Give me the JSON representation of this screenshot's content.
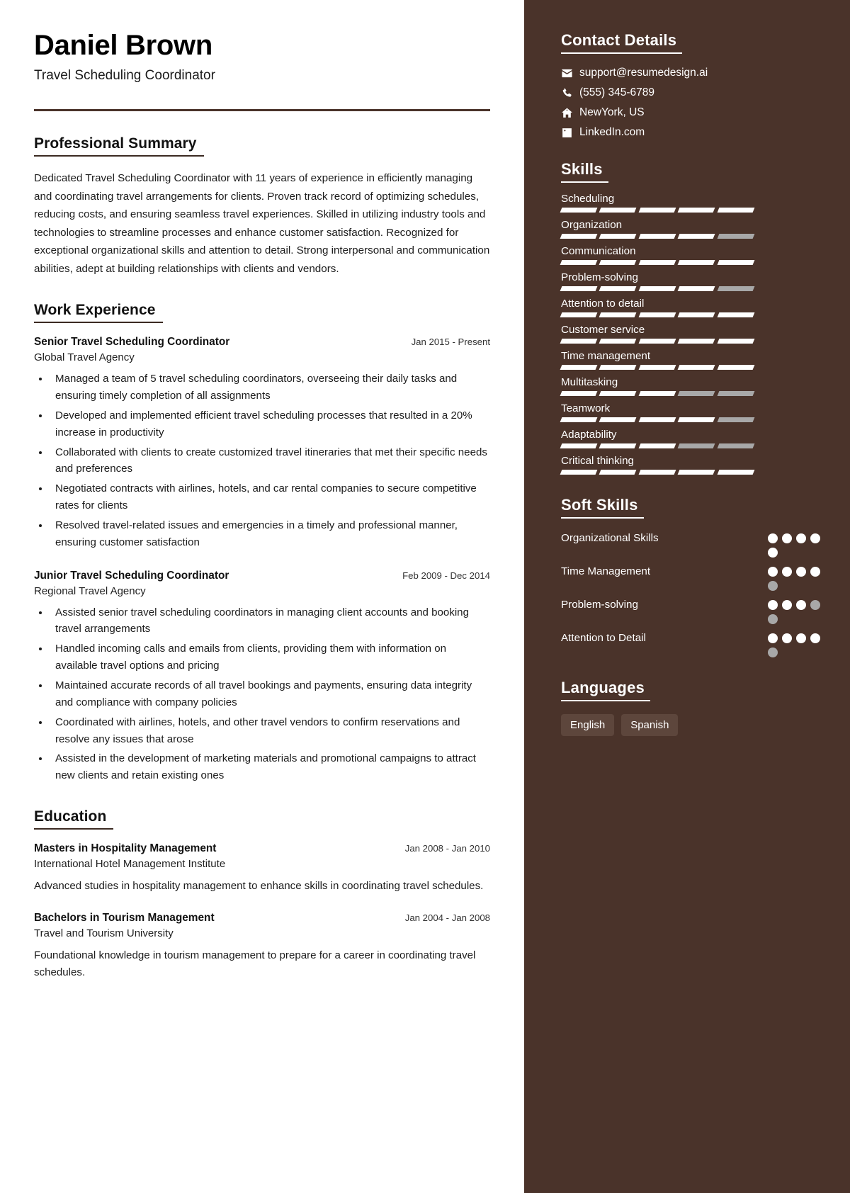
{
  "header": {
    "name": "Daniel Brown",
    "job_title": "Travel Scheduling Coordinator"
  },
  "main": {
    "summary": {
      "heading": "Professional Summary",
      "text": "Dedicated Travel Scheduling Coordinator with 11 years of experience in efficiently managing and coordinating travel arrangements for clients. Proven track record of optimizing schedules, reducing costs, and ensuring seamless travel experiences. Skilled in utilizing industry tools and technologies to streamline processes and enhance customer satisfaction. Recognized for exceptional organizational skills and attention to detail. Strong interpersonal and communication abilities, adept at building relationships with clients and vendors."
    },
    "experience": {
      "heading": "Work Experience",
      "items": [
        {
          "title": "Senior Travel Scheduling Coordinator",
          "date": "Jan 2015 - Present",
          "organization": "Global Travel Agency",
          "bullets": [
            "Managed a team of 5 travel scheduling coordinators, overseeing their daily tasks and ensuring timely completion of all assignments",
            "Developed and implemented efficient travel scheduling processes that resulted in a 20% increase in productivity",
            "Collaborated with clients to create customized travel itineraries that met their specific needs and preferences",
            "Negotiated contracts with airlines, hotels, and car rental companies to secure competitive rates for clients",
            "Resolved travel-related issues and emergencies in a timely and professional manner, ensuring customer satisfaction"
          ]
        },
        {
          "title": "Junior Travel Scheduling Coordinator",
          "date": "Feb 2009 - Dec 2014",
          "organization": "Regional Travel Agency",
          "bullets": [
            "Assisted senior travel scheduling coordinators in managing client accounts and booking travel arrangements",
            "Handled incoming calls and emails from clients, providing them with information on available travel options and pricing",
            "Maintained accurate records of all travel bookings and payments, ensuring data integrity and compliance with company policies",
            "Coordinated with airlines, hotels, and other travel vendors to confirm reservations and resolve any issues that arose",
            "Assisted in the development of marketing materials and promotional campaigns to attract new clients and retain existing ones"
          ]
        }
      ]
    },
    "education": {
      "heading": "Education",
      "items": [
        {
          "title": "Masters in Hospitality Management",
          "date": "Jan 2008 - Jan 2010",
          "organization": "International Hotel Management Institute",
          "description": "Advanced studies in hospitality management to enhance skills in coordinating travel schedules."
        },
        {
          "title": "Bachelors in Tourism Management",
          "date": "Jan 2004 - Jan 2008",
          "organization": "Travel and Tourism University",
          "description": "Foundational knowledge in tourism management to prepare for a career in coordinating travel schedules."
        }
      ]
    }
  },
  "sidebar": {
    "contact": {
      "heading": "Contact Details",
      "items": [
        {
          "icon": "envelope-icon",
          "value": "support@resumedesign.ai"
        },
        {
          "icon": "phone-icon",
          "value": "(555) 345-6789"
        },
        {
          "icon": "home-icon",
          "value": "NewYork, US"
        },
        {
          "icon": "linkedin-icon",
          "value": "LinkedIn.com"
        }
      ]
    },
    "skills": {
      "heading": "Skills",
      "segments_total": 5,
      "items": [
        {
          "name": "Scheduling",
          "filled": 5
        },
        {
          "name": "Organization",
          "filled": 4
        },
        {
          "name": "Communication",
          "filled": 5
        },
        {
          "name": "Problem-solving",
          "filled": 4
        },
        {
          "name": "Attention to detail",
          "filled": 5
        },
        {
          "name": "Customer service",
          "filled": 5
        },
        {
          "name": "Time management",
          "filled": 5
        },
        {
          "name": "Multitasking",
          "filled": 3
        },
        {
          "name": "Teamwork",
          "filled": 4
        },
        {
          "name": "Adaptability",
          "filled": 3
        },
        {
          "name": "Critical thinking",
          "filled": 5
        }
      ]
    },
    "soft_skills": {
      "heading": "Soft Skills",
      "dots_total": 5,
      "items": [
        {
          "name": "Organizational Skills",
          "filled": 5
        },
        {
          "name": "Time Management",
          "filled": 4
        },
        {
          "name": "Problem-solving",
          "filled": 3
        },
        {
          "name": "Attention to Detail",
          "filled": 4
        }
      ]
    },
    "languages": {
      "heading": "Languages",
      "items": [
        "English",
        "Spanish"
      ]
    }
  },
  "colors": {
    "sidebar_bg": "#4a332a",
    "accent_rule": "#4a332a",
    "badge_bg": "#5d463c",
    "bar_filled": "#ffffff",
    "bar_empty": "#a8a8a8"
  }
}
